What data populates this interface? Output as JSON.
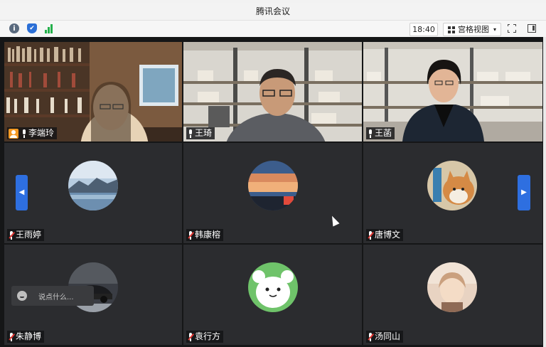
{
  "window": {
    "title": "腾讯会议"
  },
  "toolbar": {
    "time": "18:40",
    "view_label": "宫格视图",
    "view_caret": "▾",
    "info_glyph": "i",
    "shield_glyph": "✔"
  },
  "participants": [
    {
      "name": "李端玲",
      "mic": "on",
      "host": true,
      "video": true
    },
    {
      "name": "王琦",
      "mic": "on",
      "host": false,
      "video": true
    },
    {
      "name": "王菡",
      "mic": "on-green",
      "host": false,
      "video": true
    },
    {
      "name": "王雨婷",
      "mic": "muted",
      "avatar": "mountain-lake"
    },
    {
      "name": "韩康榕",
      "mic": "muted",
      "avatar": "sunset-sky"
    },
    {
      "name": "唐博文",
      "mic": "muted",
      "avatar": "shiba-dog"
    },
    {
      "name": "朱静博",
      "mic": "muted",
      "avatar": "sports-car"
    },
    {
      "name": "袁行方",
      "mic": "muted",
      "avatar": "white-cartoon-cat"
    },
    {
      "name": "汤同山",
      "mic": "muted",
      "avatar": "anime-character"
    }
  ],
  "navigation": {
    "prev_glyph": "◀",
    "next_glyph": "▶"
  },
  "chat": {
    "placeholder": "说点什么..."
  },
  "colors": {
    "accent": "#2e6fe0",
    "tile_bg": "#2b2c2f",
    "mute_red": "#e53935",
    "host_orange": "#f59a23"
  }
}
